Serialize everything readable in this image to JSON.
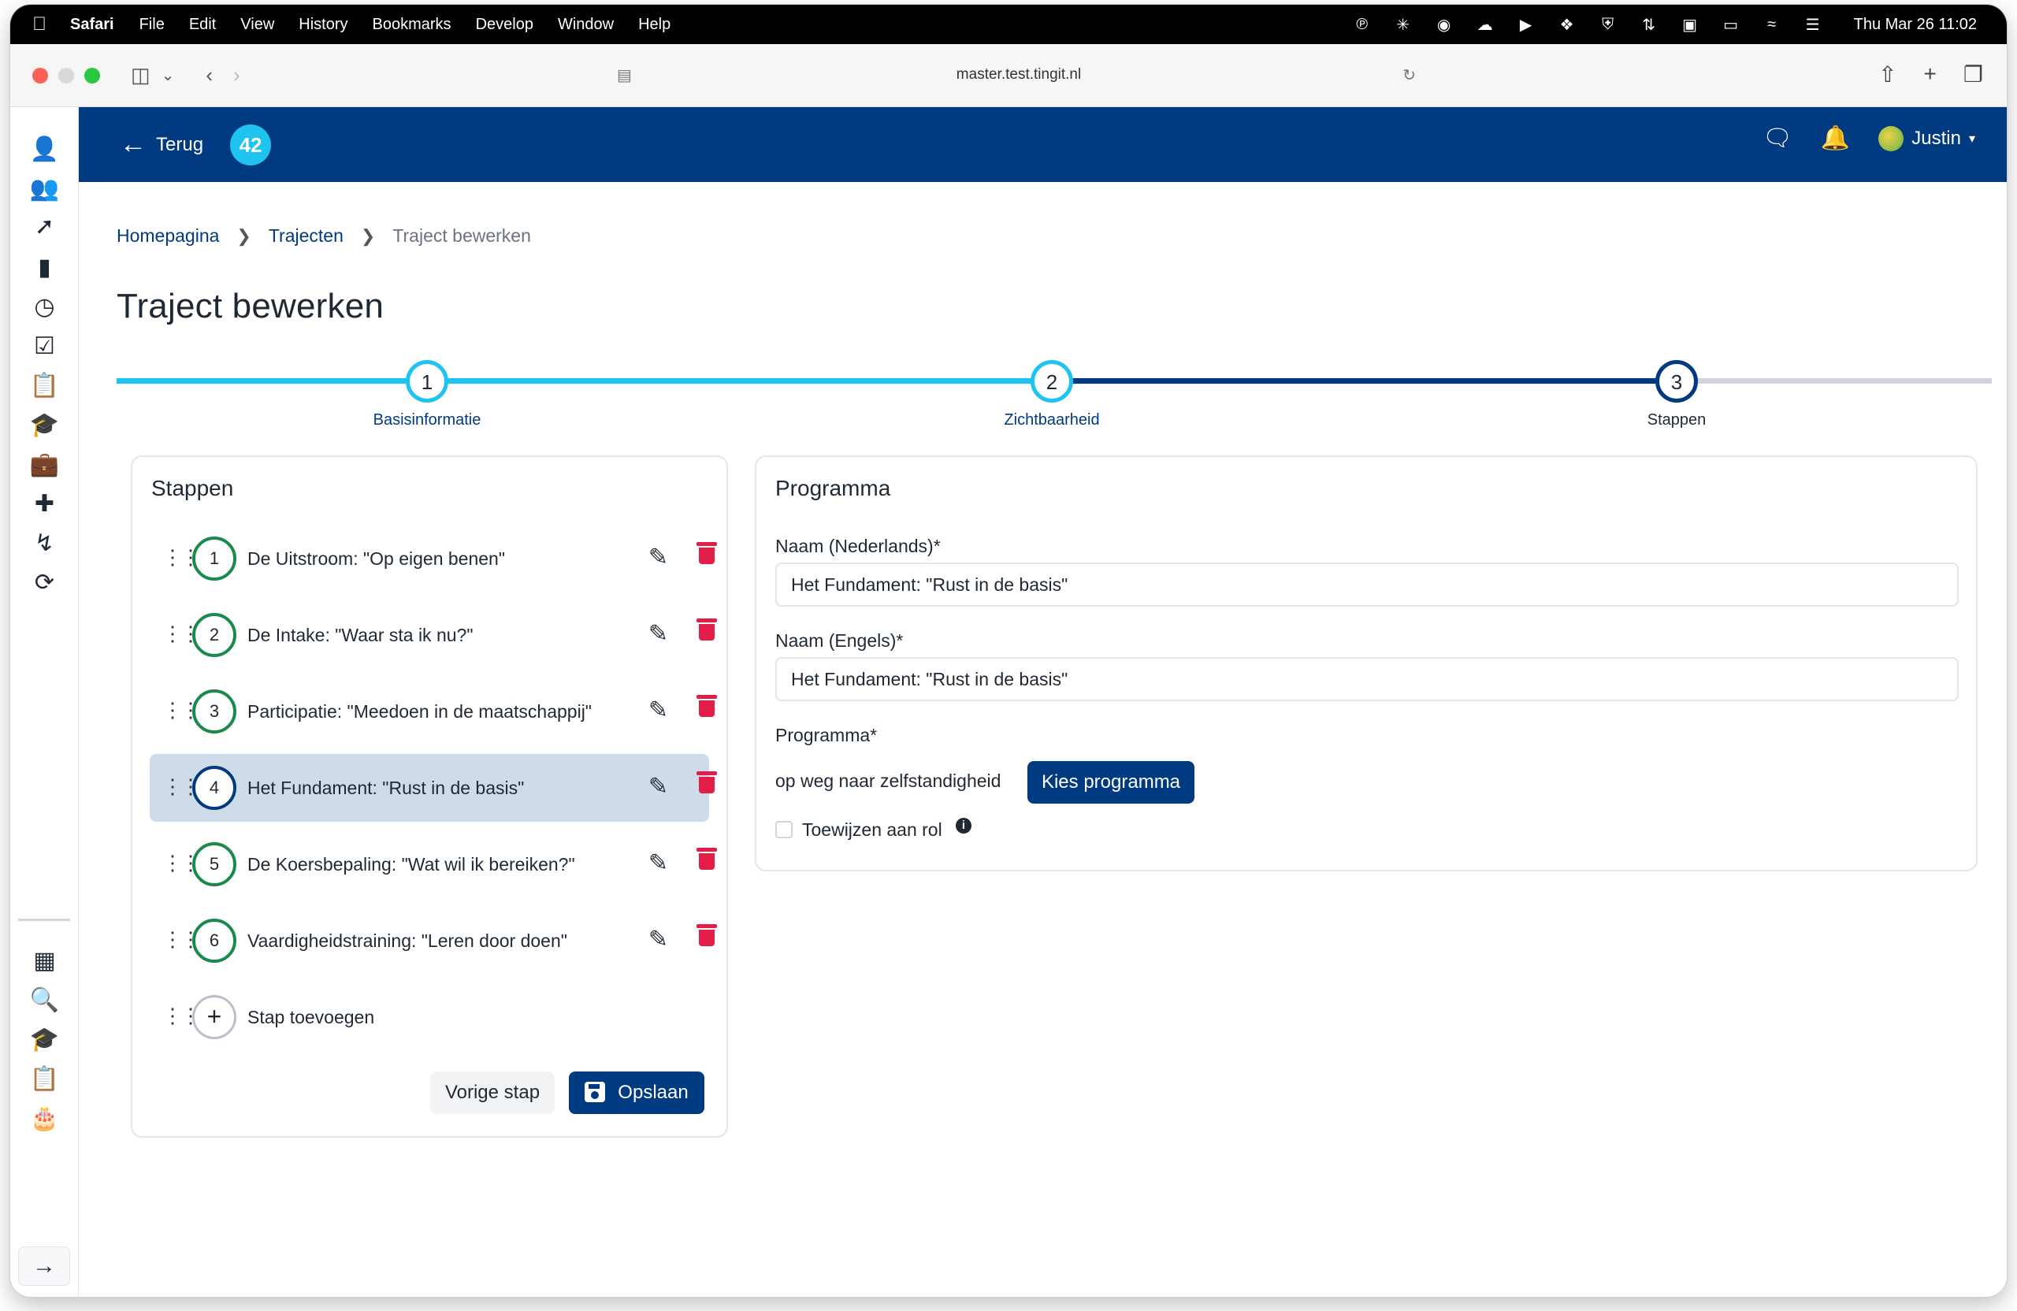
{
  "menubar": {
    "app_name": "Safari",
    "items": [
      "File",
      "Edit",
      "View",
      "History",
      "Bookmarks",
      "Develop",
      "Window",
      "Help"
    ],
    "clock": "Thu Mar 26  11:02"
  },
  "browser": {
    "url": "master.test.tingit.nl"
  },
  "topbar": {
    "back_label": "Terug",
    "logo_text": "42",
    "user_name": "Justin"
  },
  "breadcrumb": {
    "home": "Homepagina",
    "section": "Trajecten",
    "current": "Traject bewerken"
  },
  "page": {
    "title": "Traject bewerken"
  },
  "stepper": {
    "steps": [
      {
        "number": "1",
        "label": "Basisinformatie"
      },
      {
        "number": "2",
        "label": "Zichtbaarheid"
      },
      {
        "number": "3",
        "label": "Stappen"
      }
    ],
    "current_step": 3,
    "colors": {
      "done": "#1ec3f0",
      "active": "#003a80",
      "pending": "#d1d5db"
    }
  },
  "steps_card": {
    "title": "Stappen",
    "items": [
      {
        "number": "1",
        "label": "De Uitstroom: \"Op eigen benen\""
      },
      {
        "number": "2",
        "label": "De Intake: \"Waar sta ik nu?\""
      },
      {
        "number": "3",
        "label": "Participatie: \"Meedoen in de maatschappij\""
      },
      {
        "number": "4",
        "label": "Het Fundament: \"Rust in de basis\""
      },
      {
        "number": "5",
        "label": "De Koersbepaling: \"Wat wil ik bereiken?\""
      },
      {
        "number": "6",
        "label": "Vaardigheidstraining: \"Leren door doen\""
      }
    ],
    "selected_index": 3,
    "add_label": "Stap toevoegen",
    "prev_button": "Vorige stap",
    "save_button": "Opslaan"
  },
  "program_card": {
    "title": "Programma",
    "name_nl_label": "Naam (Nederlands)*",
    "name_nl_value": "Het Fundament: \"Rust in de basis\"",
    "name_en_label": "Naam (Engels)*",
    "name_en_value": "Het Fundament: \"Rust in de basis\"",
    "program_label": "Programma*",
    "program_value": "op weg naar zelfstandigheid",
    "choose_button": "Kies programma",
    "assign_role_label": "Toewijzen aan rol",
    "assign_role_checked": false
  },
  "colors": {
    "brand_blue": "#003a80",
    "accent_cyan": "#1ec3f0",
    "step_green": "#1a8a4a",
    "delete_red": "#e11d48"
  }
}
